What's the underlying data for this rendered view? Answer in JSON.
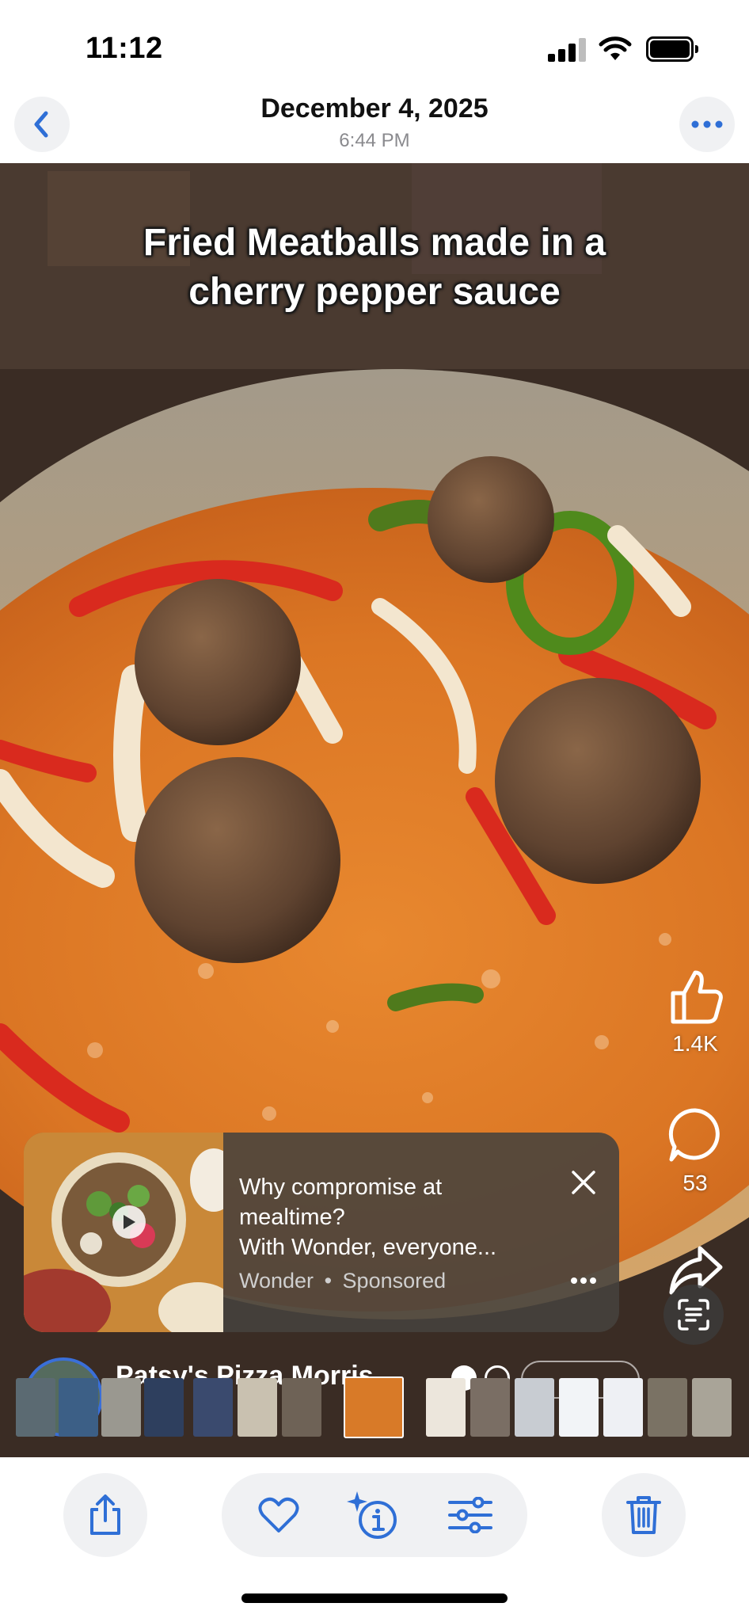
{
  "status_bar": {
    "time": "11:12"
  },
  "header": {
    "date": "December 4, 2025",
    "time": "6:44 PM"
  },
  "photo": {
    "caption_line1": "Fried Meatballs made in a",
    "caption_line2": "cherry pepper sauce"
  },
  "side_actions": {
    "like_count": "1.4K",
    "comment_count": "53"
  },
  "ad": {
    "line1": "Why compromise at",
    "line2": "mealtime?",
    "line3": "With Wonder, everyone...",
    "advertiser": "Wonder",
    "separator": "•",
    "sponsored_label": "Sponsored"
  },
  "poster": {
    "name": "Patsy's Pizza Morris..."
  },
  "colors": {
    "accent": "#2f6fd6",
    "toolbar_bg": "#f0f1f3"
  }
}
